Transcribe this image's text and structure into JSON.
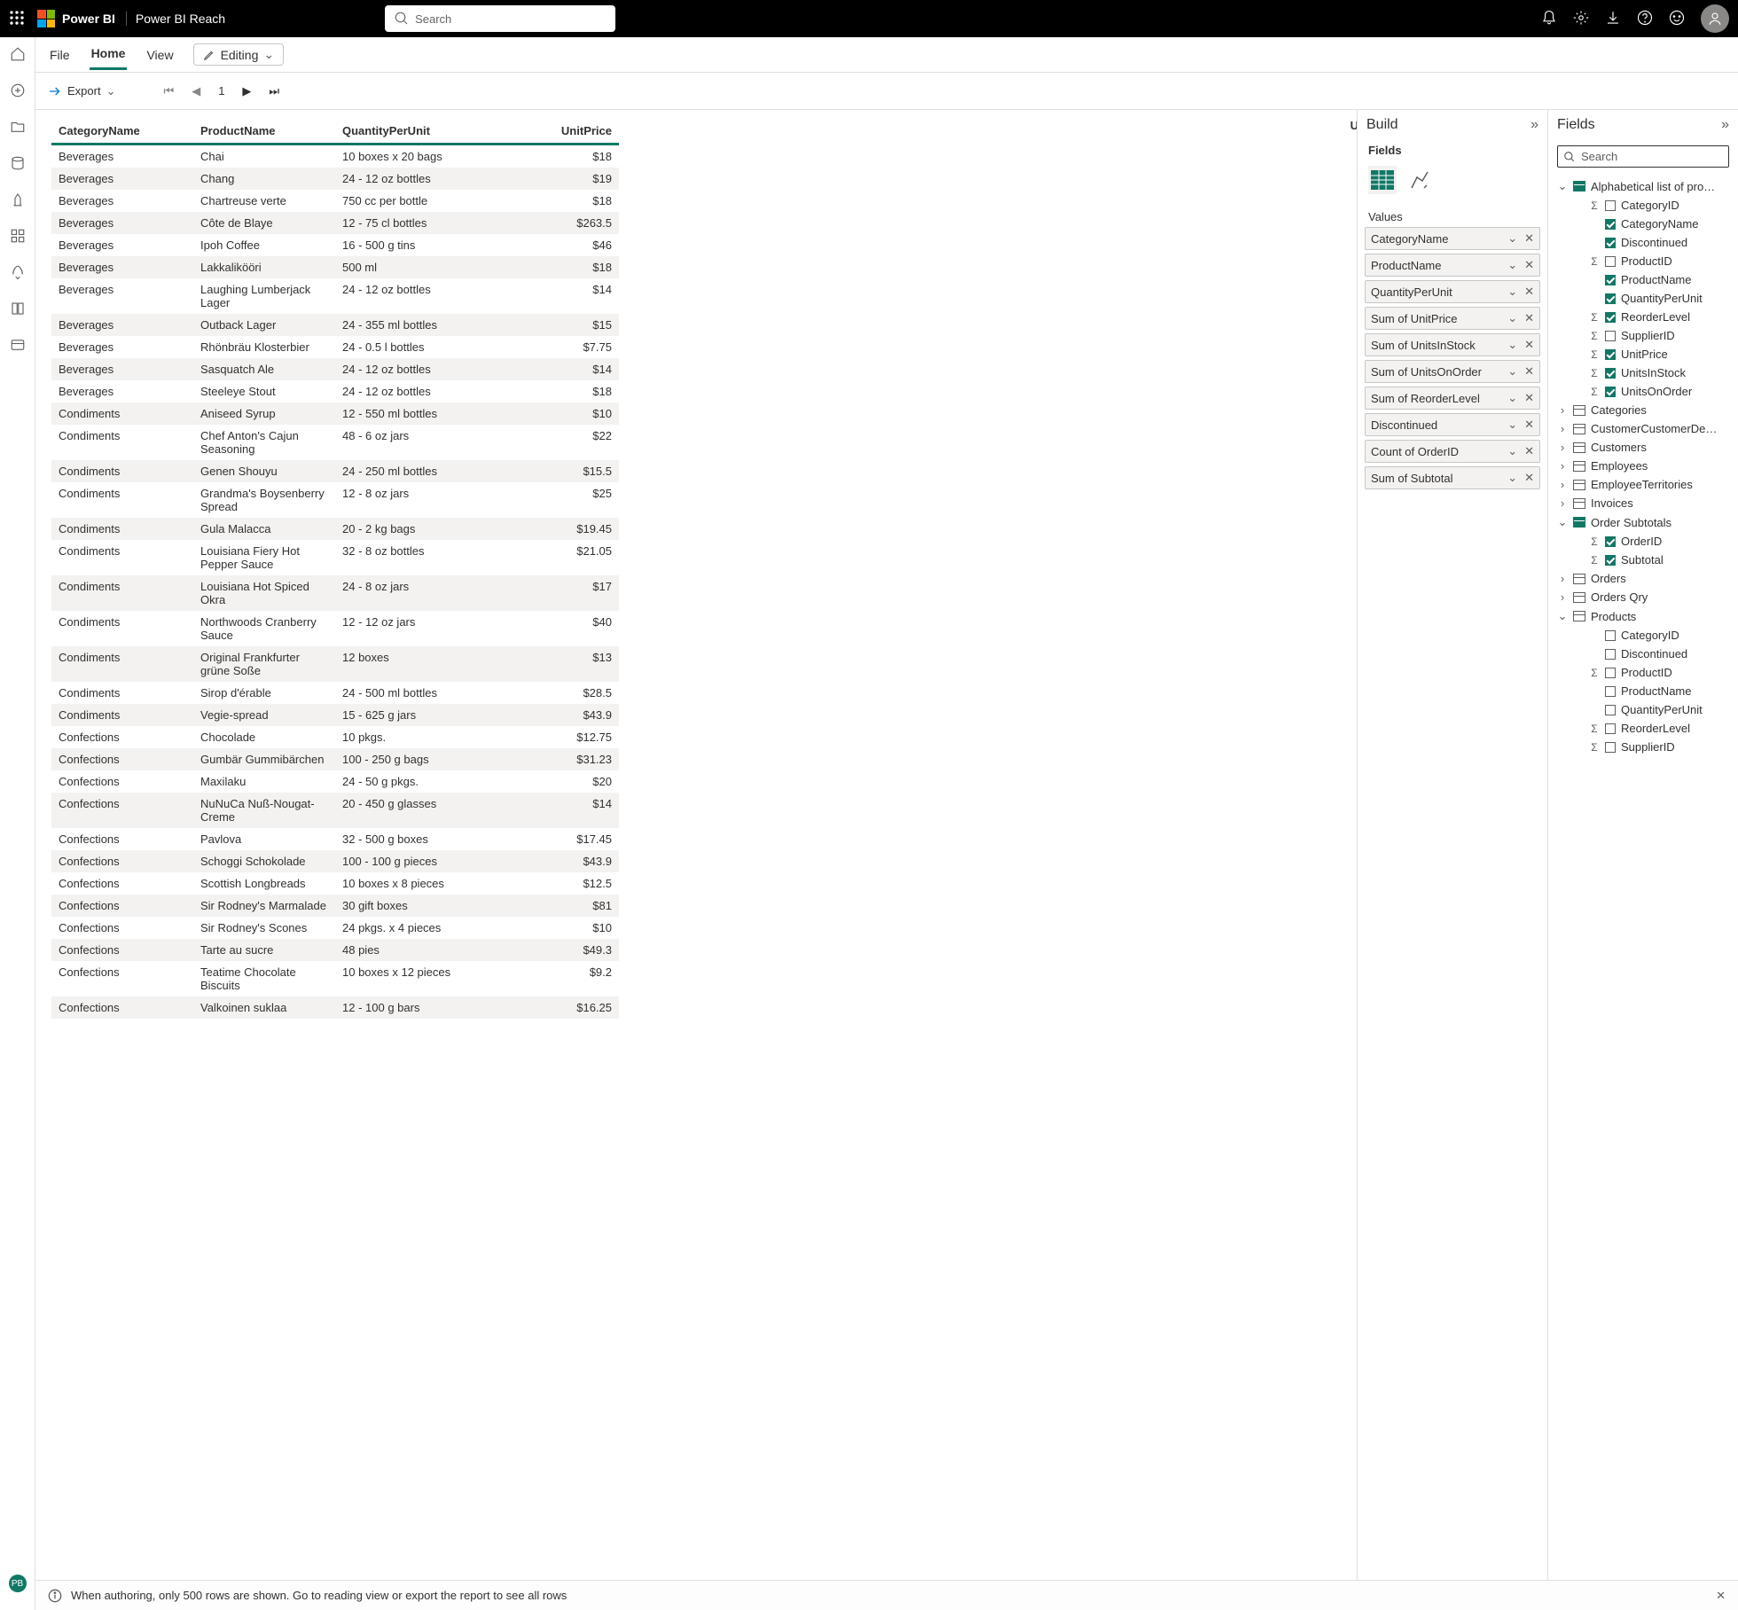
{
  "top": {
    "brand": "Power BI",
    "workspace": "Power BI Reach",
    "search_ph": "Search"
  },
  "ribbon": {
    "file": "File",
    "home": "Home",
    "view": "View",
    "editing": "Editing"
  },
  "toolrow": {
    "export": "Export",
    "page": "1"
  },
  "leftbadge": "PB",
  "buildpane": {
    "title": "Build",
    "fields": "Fields",
    "values": "Values",
    "wells": [
      "CategoryName",
      "ProductName",
      "QuantityPerUnit",
      "Sum of UnitPrice",
      "Sum of UnitsInStock",
      "Sum of UnitsOnOrder",
      "Sum of ReorderLevel",
      "Discontinued",
      "Count of OrderID",
      "Sum of Subtotal"
    ]
  },
  "fieldspane": {
    "title": "Fields",
    "search_ph": "Search",
    "tree": [
      {
        "type": "table",
        "label": "Alphabetical list of pro…",
        "open": true,
        "filled": true,
        "children": [
          {
            "label": "CategoryID",
            "sigma": true,
            "chk": false
          },
          {
            "label": "CategoryName",
            "chk": true
          },
          {
            "label": "Discontinued",
            "chk": true
          },
          {
            "label": "ProductID",
            "sigma": true,
            "chk": false
          },
          {
            "label": "ProductName",
            "chk": true
          },
          {
            "label": "QuantityPerUnit",
            "chk": true
          },
          {
            "label": "ReorderLevel",
            "sigma": true,
            "chk": true
          },
          {
            "label": "SupplierID",
            "sigma": true,
            "chk": false
          },
          {
            "label": "UnitPrice",
            "sigma": true,
            "chk": true
          },
          {
            "label": "UnitsInStock",
            "sigma": true,
            "chk": true
          },
          {
            "label": "UnitsOnOrder",
            "sigma": true,
            "chk": true
          }
        ]
      },
      {
        "type": "table",
        "label": "Categories",
        "open": false
      },
      {
        "type": "table",
        "label": "CustomerCustomerDe…",
        "open": false
      },
      {
        "type": "table",
        "label": "Customers",
        "open": false
      },
      {
        "type": "table",
        "label": "Employees",
        "open": false
      },
      {
        "type": "table",
        "label": "EmployeeTerritories",
        "open": false
      },
      {
        "type": "table",
        "label": "Invoices",
        "open": false
      },
      {
        "type": "table",
        "label": "Order Subtotals",
        "open": true,
        "filled": true,
        "children": [
          {
            "label": "OrderID",
            "sigma": true,
            "chk": true
          },
          {
            "label": "Subtotal",
            "sigma": true,
            "chk": true
          }
        ]
      },
      {
        "type": "table",
        "label": "Orders",
        "open": false
      },
      {
        "type": "table",
        "label": "Orders Qry",
        "open": false
      },
      {
        "type": "table",
        "label": "Products",
        "open": true,
        "filled": false,
        "children": [
          {
            "label": "CategoryID",
            "chk": false
          },
          {
            "label": "Discontinued",
            "chk": false
          },
          {
            "label": "ProductID",
            "sigma": true,
            "chk": false
          },
          {
            "label": "ProductName",
            "chk": false
          },
          {
            "label": "QuantityPerUnit",
            "chk": false
          },
          {
            "label": "ReorderLevel",
            "sigma": true,
            "chk": false
          },
          {
            "label": "SupplierID",
            "sigma": true,
            "chk": false
          }
        ]
      }
    ]
  },
  "table": {
    "headers": [
      "CategoryName",
      "ProductName",
      "QuantityPerUnit",
      "UnitPrice"
    ],
    "cut": "U",
    "rows": [
      [
        "Beverages",
        "Chai",
        "10 boxes x 20 bags",
        "$18"
      ],
      [
        "Beverages",
        "Chang",
        "24 - 12 oz bottles",
        "$19"
      ],
      [
        "Beverages",
        "Chartreuse verte",
        "750 cc per bottle",
        "$18"
      ],
      [
        "Beverages",
        "Côte de Blaye",
        "12 - 75 cl bottles",
        "$263.5"
      ],
      [
        "Beverages",
        "Ipoh Coffee",
        "16 - 500 g tins",
        "$46"
      ],
      [
        "Beverages",
        "Lakkalikööri",
        "500 ml",
        "$18"
      ],
      [
        "Beverages",
        "Laughing Lumberjack Lager",
        "24 - 12 oz bottles",
        "$14"
      ],
      [
        "Beverages",
        "Outback Lager",
        "24 - 355 ml bottles",
        "$15"
      ],
      [
        "Beverages",
        "Rhönbräu Klosterbier",
        "24 - 0.5 l bottles",
        "$7.75"
      ],
      [
        "Beverages",
        "Sasquatch Ale",
        "24 - 12 oz bottles",
        "$14"
      ],
      [
        "Beverages",
        "Steeleye Stout",
        "24 - 12 oz bottles",
        "$18"
      ],
      [
        "Condiments",
        "Aniseed Syrup",
        "12 - 550 ml bottles",
        "$10"
      ],
      [
        "Condiments",
        "Chef Anton's Cajun Seasoning",
        "48 - 6 oz jars",
        "$22"
      ],
      [
        "Condiments",
        "Genen Shouyu",
        "24 - 250 ml bottles",
        "$15.5"
      ],
      [
        "Condiments",
        "Grandma's Boysenberry Spread",
        "12 - 8 oz jars",
        "$25"
      ],
      [
        "Condiments",
        "Gula Malacca",
        "20 - 2 kg bags",
        "$19.45"
      ],
      [
        "Condiments",
        "Louisiana Fiery Hot Pepper Sauce",
        "32 - 8 oz bottles",
        "$21.05"
      ],
      [
        "Condiments",
        "Louisiana Hot Spiced Okra",
        "24 - 8 oz jars",
        "$17"
      ],
      [
        "Condiments",
        "Northwoods Cranberry Sauce",
        "12 - 12 oz jars",
        "$40"
      ],
      [
        "Condiments",
        "Original Frankfurter grüne Soße",
        "12 boxes",
        "$13"
      ],
      [
        "Condiments",
        "Sirop d'érable",
        "24 - 500 ml bottles",
        "$28.5"
      ],
      [
        "Condiments",
        "Vegie-spread",
        "15 - 625 g jars",
        "$43.9"
      ],
      [
        "Confections",
        "Chocolade",
        "10 pkgs.",
        "$12.75"
      ],
      [
        "Confections",
        "Gumbär Gummibärchen",
        "100 - 250 g bags",
        "$31.23"
      ],
      [
        "Confections",
        "Maxilaku",
        "24 - 50 g pkgs.",
        "$20"
      ],
      [
        "Confections",
        "NuNuCa Nuß-Nougat-Creme",
        "20 - 450 g glasses",
        "$14"
      ],
      [
        "Confections",
        "Pavlova",
        "32 - 500 g boxes",
        "$17.45"
      ],
      [
        "Confections",
        "Schoggi Schokolade",
        "100 - 100 g pieces",
        "$43.9"
      ],
      [
        "Confections",
        "Scottish Longbreads",
        "10 boxes x 8 pieces",
        "$12.5"
      ],
      [
        "Confections",
        "Sir Rodney's Marmalade",
        "30 gift boxes",
        "$81"
      ],
      [
        "Confections",
        "Sir Rodney's Scones",
        "24 pkgs. x 4 pieces",
        "$10"
      ],
      [
        "Confections",
        "Tarte au sucre",
        "48 pies",
        "$49.3"
      ],
      [
        "Confections",
        "Teatime Chocolate Biscuits",
        "10 boxes x 12 pieces",
        "$9.2"
      ],
      [
        "Confections",
        "Valkoinen suklaa",
        "12 - 100 g bars",
        "$16.25"
      ]
    ]
  },
  "info": "When authoring, only 500 rows are shown. Go to reading view or export the report to see all rows"
}
